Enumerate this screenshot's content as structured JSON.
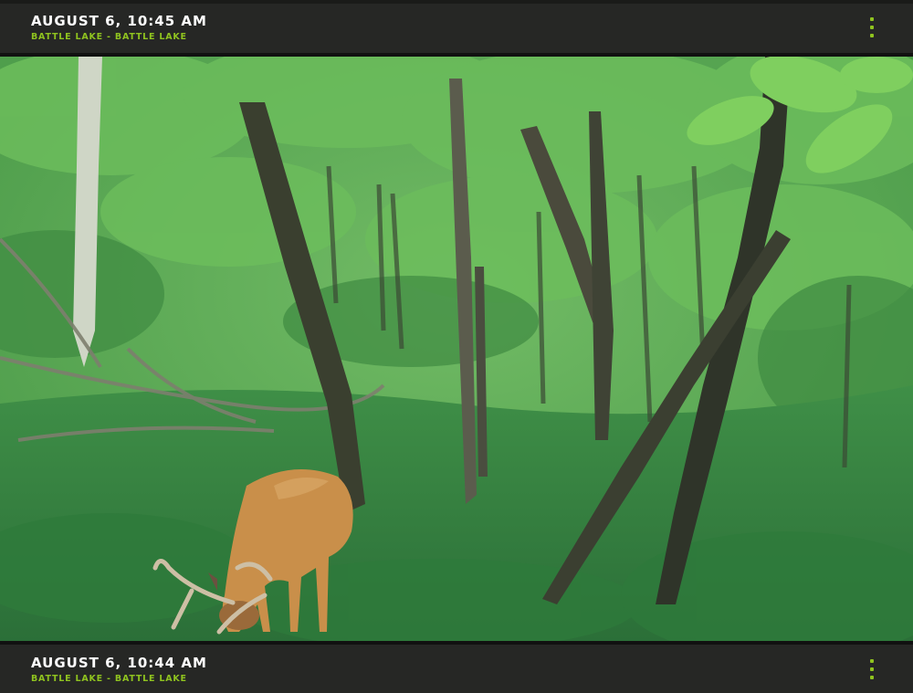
{
  "cards": [
    {
      "timestamp": "AUGUST 6, 10:45 AM",
      "location": "BATTLE LAKE - BATTLE LAKE",
      "menu_icon": "kebab-menu-icon"
    },
    {
      "timestamp": "AUGUST 6, 10:44 AM",
      "location": "BATTLE LAKE - BATTLE LAKE",
      "menu_icon": "kebab-menu-icon"
    }
  ],
  "colors": {
    "bar_background": "#262725",
    "timestamp_text": "#ffffff",
    "location_text": "#8fc31f",
    "menu_dots": "#8fc31f"
  }
}
